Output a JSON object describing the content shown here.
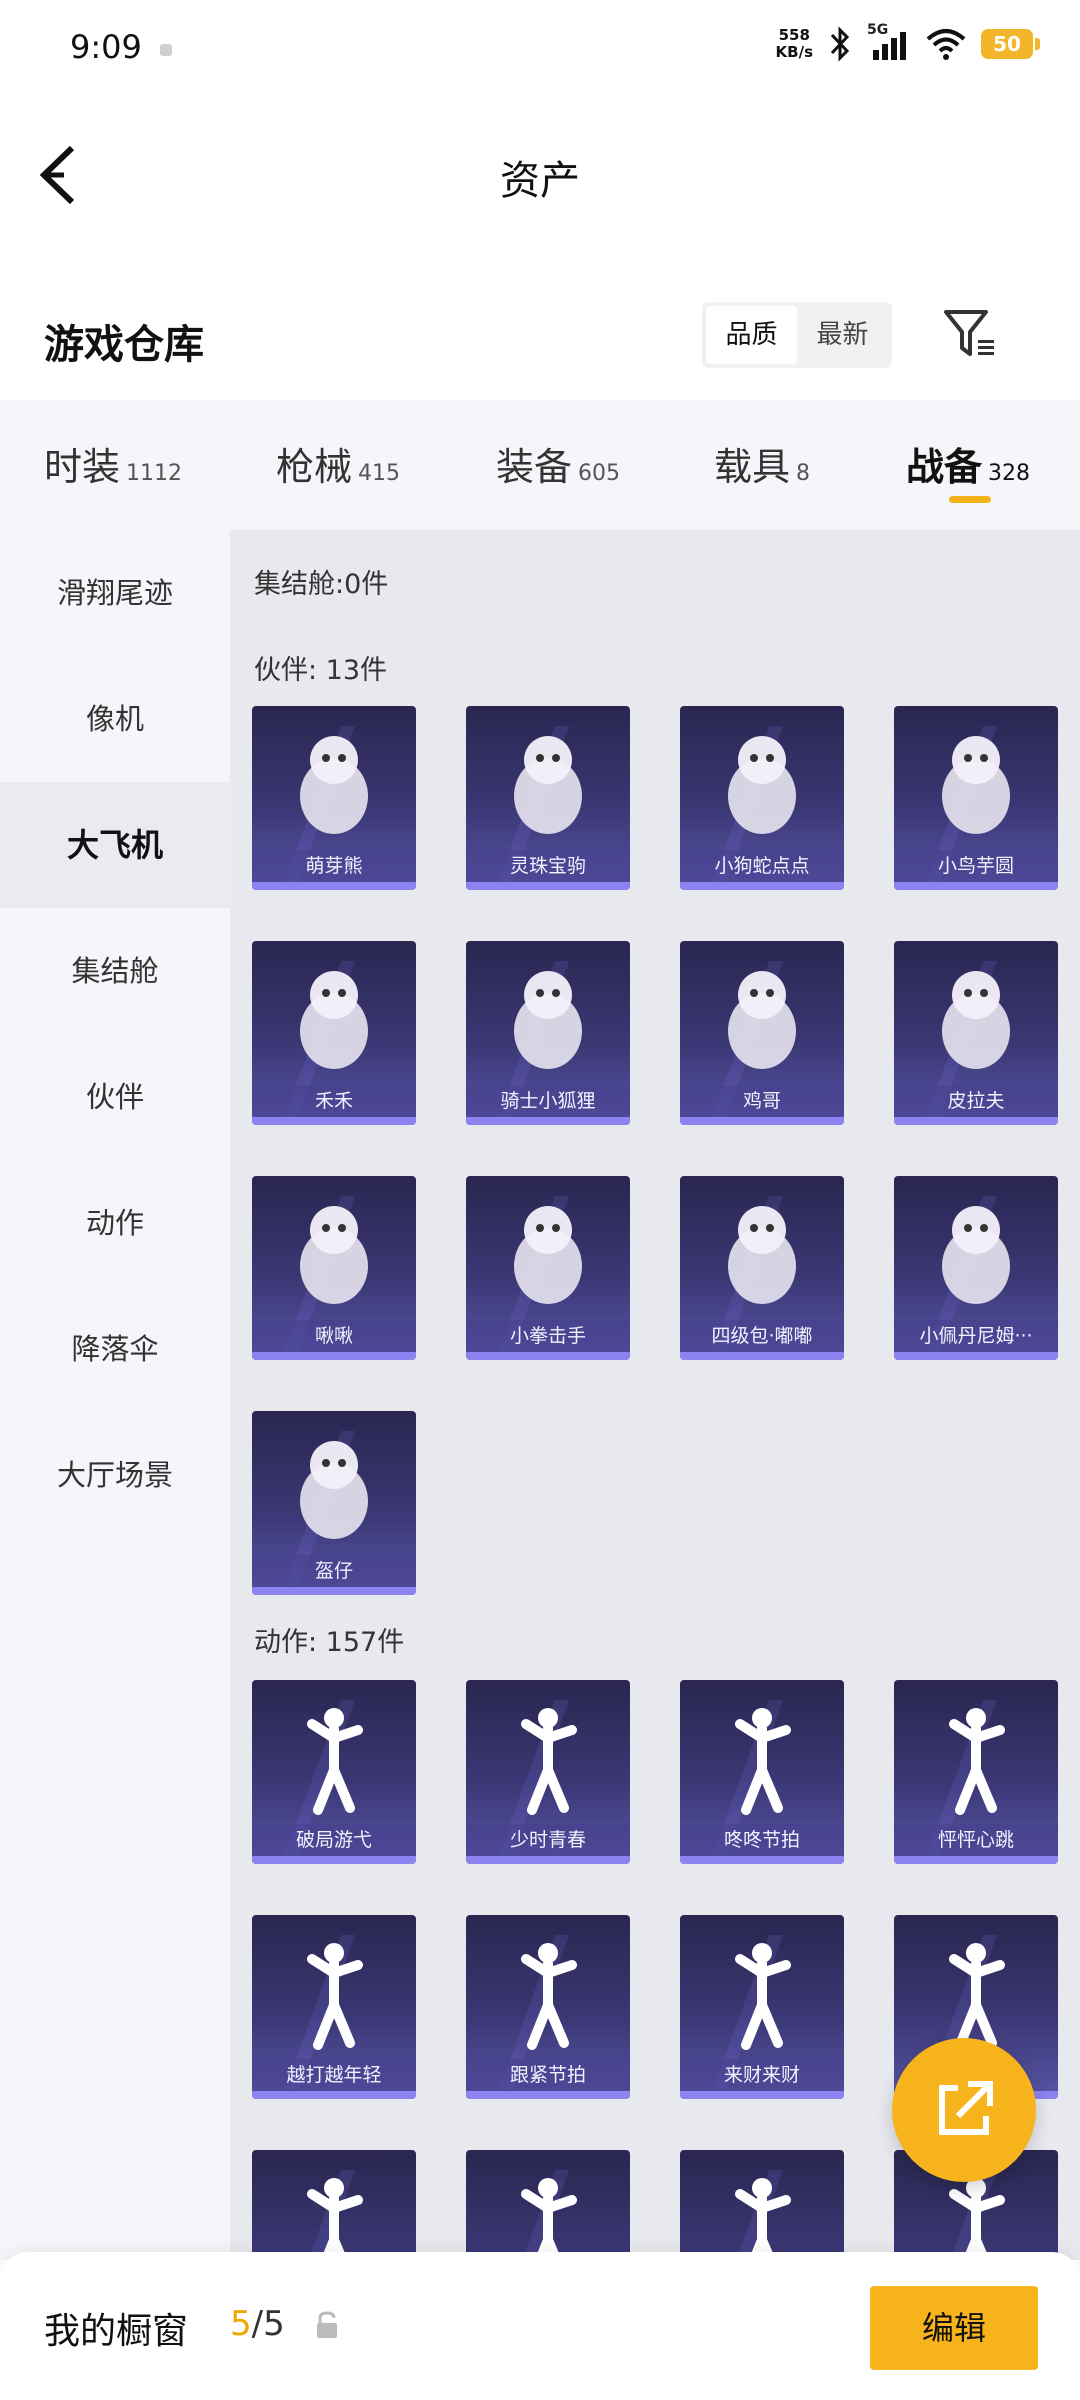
{
  "status": {
    "time": "9:09",
    "net_speed": "558",
    "net_unit": "KB/s",
    "network": "5G",
    "battery": "50"
  },
  "header": {
    "title": "资产"
  },
  "warehouse": {
    "title": "游戏仓库",
    "sort_options": [
      "品质",
      "最新"
    ],
    "active_sort": "品质"
  },
  "tabs": [
    {
      "name": "时装",
      "count": "1112"
    },
    {
      "name": "枪械",
      "count": "415"
    },
    {
      "name": "装备",
      "count": "605"
    },
    {
      "name": "载具",
      "count": "8"
    },
    {
      "name": "战备",
      "count": "328"
    }
  ],
  "sidebar": {
    "items": [
      "滑翔尾迹",
      "像机",
      "大飞机",
      "集结舱",
      "伙伴",
      "动作",
      "降落伞",
      "大厅场景"
    ],
    "active_index": 2
  },
  "sections": {
    "rally": {
      "label": "集结舱:0件"
    },
    "partner": {
      "label": "伙伴: 13件",
      "items": [
        "萌芽熊",
        "灵珠宝驹",
        "小狗蛇点点",
        "小鸟芋圆",
        "禾禾",
        "骑士小狐狸",
        "鸡哥",
        "皮拉夫",
        "啾啾",
        "小拳击手",
        "四级包·嘟嘟",
        "小佩丹尼姆···",
        "盔仔"
      ]
    },
    "action": {
      "label": "动作: 157件",
      "items": [
        "破局游弋",
        "少时青春",
        "咚咚节拍",
        "怦怦心跳",
        "越打越年轻",
        "跟紧节拍",
        "来财来财",
        "",
        "",
        "",
        "",
        ""
      ]
    }
  },
  "bottom": {
    "label": "我的橱窗",
    "count_current": "5",
    "count_total": "/5",
    "edit_label": "编辑"
  },
  "colors": {
    "accent": "#f6b31c",
    "card_bg": "#3a3774",
    "card_bar": "#8c83f0"
  }
}
